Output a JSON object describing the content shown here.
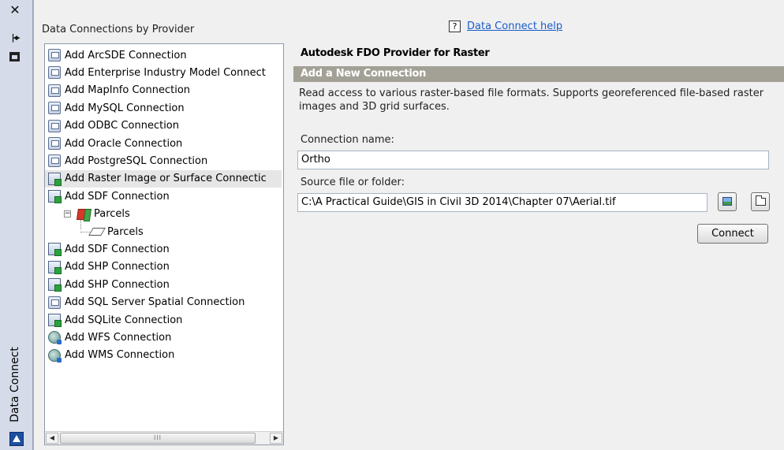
{
  "palette": {
    "title": "Data Connect",
    "close_glyph": "✕",
    "autohide_glyph": "|◂▸"
  },
  "panel": {
    "group_label": "Data Connections by Provider",
    "help": {
      "box_glyph": "?",
      "link": "Data Connect help"
    },
    "tree": [
      {
        "label": "Add ArcSDE Connection",
        "icon": "database-icon"
      },
      {
        "label": "Add Enterprise Industry Model Connect",
        "icon": "database-icon"
      },
      {
        "label": "Add MapInfo Connection",
        "icon": "database-icon"
      },
      {
        "label": "Add MySQL Connection",
        "icon": "database-icon"
      },
      {
        "label": "Add ODBC Connection",
        "icon": "database-icon"
      },
      {
        "label": "Add Oracle Connection",
        "icon": "database-icon"
      },
      {
        "label": "Add PostgreSQL Connection",
        "icon": "database-icon"
      },
      {
        "label": "Add Raster Image or Surface Connectic",
        "icon": "raster-file-icon",
        "selected": true
      },
      {
        "label": "Add SDF Connection",
        "icon": "file-icon"
      },
      {
        "label": "Parcels",
        "icon": "layer-icon",
        "expander": "−"
      },
      {
        "label": "Parcels",
        "icon": "feature-class-icon"
      },
      {
        "label": "Add SDF Connection",
        "icon": "file-icon"
      },
      {
        "label": "Add SHP Connection",
        "icon": "file-icon"
      },
      {
        "label": "Add SHP Connection",
        "icon": "file-icon"
      },
      {
        "label": "Add SQL Server Spatial Connection",
        "icon": "database-icon"
      },
      {
        "label": "Add SQLite Connection",
        "icon": "file-icon"
      },
      {
        "label": "Add WFS Connection",
        "icon": "globe-icon"
      },
      {
        "label": "Add WMS Connection",
        "icon": "globe-icon"
      }
    ],
    "scrollbar": {
      "left": "◀",
      "right": "▶",
      "thumb": "III"
    },
    "provider_title": "Autodesk FDO Provider for Raster",
    "section_title": "Add a New Connection",
    "description": "Read access to various raster-based file formats. Supports georeferenced file-based raster images and 3D grid surfaces.",
    "connection_name_label": "Connection name:",
    "connection_name_value": "Ortho",
    "source_label": "Source file or folder:",
    "source_value": "C:\\A Practical Guide\\GIS in Civil 3D 2014\\Chapter 07\\Aerial.tif",
    "connect_label": "Connect"
  }
}
